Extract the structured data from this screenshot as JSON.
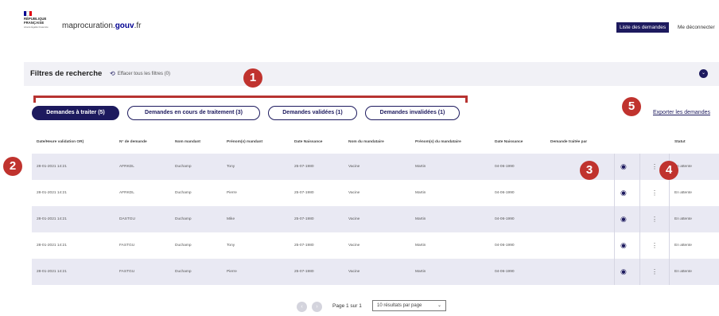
{
  "header": {
    "republique": "RÉPUBLIQUE FRANÇAISE",
    "motto": "Liberté Égalité Fraternité",
    "site_prefix": "maprocuration.",
    "site_bold": "gouv",
    "site_suffix": ".fr",
    "list_button": "Liste des demandes",
    "logout_button": "Me déconnecter",
    "flag_colors": [
      "#000091",
      "#ffffff",
      "#e1000f"
    ]
  },
  "filters": {
    "title": "Filtres de recherche",
    "clear_label": "Effacer tous les filtres (0)",
    "toggle_icon": "chevron-down-icon"
  },
  "tabs": [
    {
      "label": "Demandes à traiter (5)",
      "active": true
    },
    {
      "label": "Demandes en cours de traitement (3)",
      "active": false
    },
    {
      "label": "Demandes validées (1)",
      "active": false
    },
    {
      "label": "Demandes invalidées (1)",
      "active": false
    }
  ],
  "export_label": "Exporter les demandes",
  "table": {
    "headers": [
      "Date/Heure validation OR)",
      "N° de demande",
      "Nom mandant",
      "Prénom(s) mandant",
      "Date Naissance",
      "Nom du mandataire",
      "Prénom(s) du mandataire",
      "Date Naissance",
      "Demande traitée par",
      "",
      "",
      "Statut"
    ],
    "rows": [
      [
        "28-01-2021 14:21",
        "AFRKDL",
        "Duchamp",
        "Tony",
        "25-07-1980",
        "Vacine",
        "Martin",
        "04-06-1990",
        "",
        "En attente"
      ],
      [
        "28-01-2021 14:21",
        "AFRKDL",
        "Duchamp",
        "Pierre",
        "25-07-1980",
        "Vacine",
        "Martin",
        "04-06-1990",
        "",
        "En attente"
      ],
      [
        "28-01-2021 14:21",
        "DASTGU",
        "Duchamp",
        "Mike",
        "25-07-1980",
        "Vacine",
        "Martin",
        "04-06-1990",
        "",
        "En attente"
      ],
      [
        "28-01-2021 14:21",
        "FASTGU",
        "Duchamp",
        "Tony",
        "25-07-1980",
        "Vacine",
        "Martin",
        "04-06-1990",
        "",
        "En attente"
      ],
      [
        "28-01-2021 14:21",
        "FASTGU",
        "Duchamp",
        "Pierre",
        "25-07-1980",
        "Vacine",
        "Martin",
        "04-06-1990",
        "",
        "En attente"
      ]
    ],
    "view_icon": "eye-icon",
    "menu_icon": "kebab-menu-icon"
  },
  "pagination": {
    "page_label": "Page 1 sur 1",
    "per_page": "10 résultats par page",
    "prev_icon": "chevron-left-icon",
    "next_icon": "chevron-right-icon"
  },
  "annotations": [
    "1",
    "2",
    "3",
    "4",
    "5"
  ],
  "colors": {
    "primary": "#1d1a5e",
    "annotation": "#c0332e",
    "row_alt": "#e9e9f3"
  }
}
